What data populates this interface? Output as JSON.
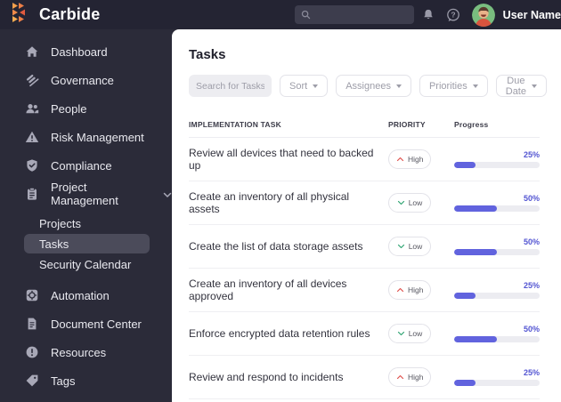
{
  "brand": {
    "name": "Carbide",
    "logo_icon": "carbide-triangles-icon"
  },
  "colors": {
    "topbar_bg": "#242433",
    "sidebar_bg": "#2b2b39",
    "selected_item_bg": "#4b4b5a",
    "brand_orange": "#EF8549",
    "progress_accent": "#6163DE",
    "progress_label": "#5355D2",
    "priority_high": "#E0524F",
    "priority_low": "#2FA472"
  },
  "topbar": {
    "search_placeholder": "",
    "icons": [
      "search-icon",
      "bell-icon",
      "help-icon"
    ],
    "user_name": "User Name"
  },
  "sidebar": {
    "items_top": [
      {
        "label": "Dashboard",
        "icon": "home-icon"
      },
      {
        "label": "Governance",
        "icon": "gavel-icon"
      },
      {
        "label": "People",
        "icon": "people-icon"
      },
      {
        "label": "Risk Management",
        "icon": "warning-triangle-icon"
      },
      {
        "label": "Compliance",
        "icon": "shield-check-icon"
      },
      {
        "label": "Project Management",
        "icon": "clipboard-icon",
        "expanded": true
      }
    ],
    "sub_items": [
      {
        "label": "Projects",
        "selected": false
      },
      {
        "label": "Tasks",
        "selected": true
      },
      {
        "label": "Security Calendar",
        "selected": false
      }
    ],
    "items_bottom": [
      {
        "label": "Automation",
        "icon": "automation-gear-icon"
      },
      {
        "label": "Document Center",
        "icon": "document-icon"
      },
      {
        "label": "Resources",
        "icon": "exclamation-circle-icon"
      },
      {
        "label": "Tags",
        "icon": "tag-icon"
      }
    ]
  },
  "main": {
    "title": "Tasks",
    "filters": {
      "search_placeholder": "Search for Tasks",
      "dropdowns": [
        {
          "label": "Sort"
        },
        {
          "label": "Assignees"
        },
        {
          "label": "Priorities"
        },
        {
          "label": "Due Date"
        }
      ]
    },
    "table": {
      "col_task": "IMPLEMENTATION TASK",
      "col_priority": "PRIORITY",
      "col_progress": "Progress",
      "rows": [
        {
          "task": "Review all devices that need to backed up",
          "priority": "High",
          "progress": 25,
          "progress_label": "25%"
        },
        {
          "task": "Create an inventory of all physical assets",
          "priority": "Low",
          "progress": 50,
          "progress_label": "50%"
        },
        {
          "task": "Create the list of data storage assets",
          "priority": "Low",
          "progress": 50,
          "progress_label": "50%"
        },
        {
          "task": "Create an inventory of all devices approved",
          "priority": "High",
          "progress": 25,
          "progress_label": "25%"
        },
        {
          "task": "Enforce encrypted data retention rules",
          "priority": "Low",
          "progress": 50,
          "progress_label": "50%"
        },
        {
          "task": "Review and respond to incidents",
          "priority": "High",
          "progress": 25,
          "progress_label": "25%"
        }
      ]
    }
  }
}
